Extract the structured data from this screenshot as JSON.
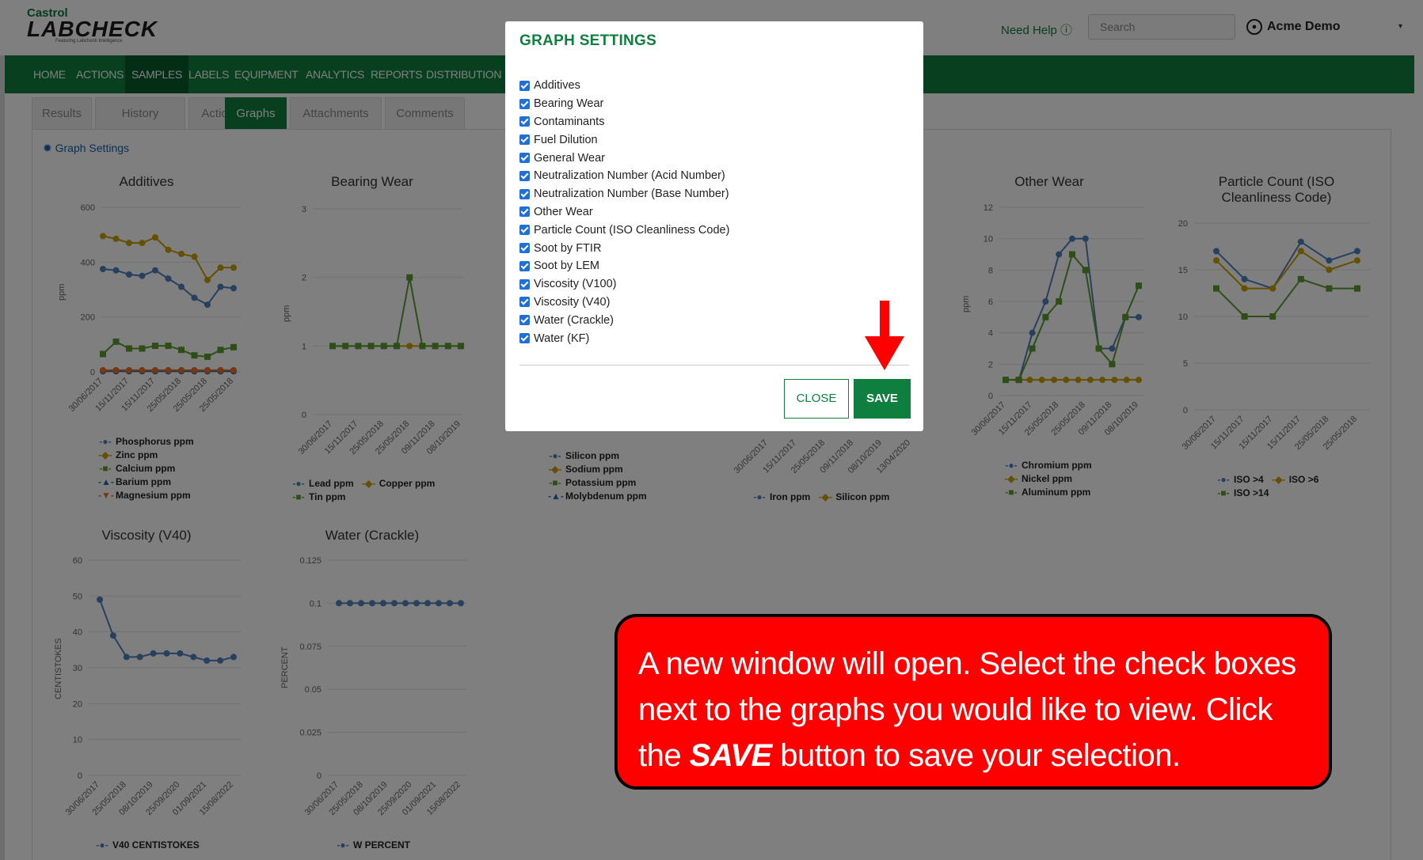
{
  "app": {
    "brand": "Castrol",
    "logo": "LABCHECK",
    "logo_sub": "Featuring Labcheck Intelligence",
    "help": "Need Help ⓘ",
    "search_placeholder": "Search",
    "user": "Acme Demo"
  },
  "nav": [
    "HOME",
    "ACTIONS",
    "SAMPLES",
    "LABELS",
    "EQUIPMENT",
    "ANALYTICS",
    "REPORTS",
    "DISTRIBUTION"
  ],
  "nav_active": "SAMPLES",
  "tabs": [
    "Results",
    "History",
    "Actions",
    "Graphs",
    "Attachments",
    "Comments"
  ],
  "tab_active": "Graphs",
  "graph_settings_link": "Graph Settings",
  "charts": {
    "additives": {
      "title": "Additives",
      "ylabel": "ppm",
      "yticks": [
        "600",
        "400",
        "200",
        "0"
      ],
      "xticks": [
        "30/06/2017",
        "15/11/2017",
        "15/11/2017",
        "25/05/2018",
        "25/05/2018",
        "25/05/2018"
      ],
      "legend": [
        "Phosphorus ppm",
        "Zinc ppm",
        "Calcium ppm",
        "Barium ppm",
        "Magnesium ppm"
      ]
    },
    "bearing": {
      "title": "Bearing Wear",
      "ylabel": "ppm",
      "yticks": [
        "3",
        "2",
        "1",
        "0"
      ],
      "xticks": [
        "30/06/2017",
        "15/11/2017",
        "25/05/2018",
        "25/05/2018",
        "09/11/2018",
        "08/10/2019"
      ],
      "legend": [
        "Lead ppm",
        "Copper ppm",
        "Tin ppm"
      ]
    },
    "contaminants": {
      "legend": [
        "Silicon ppm",
        "Sodium ppm",
        "Potassium ppm",
        "Molybdenum ppm"
      ]
    },
    "general": {
      "xticks": [
        "30/06/2017",
        "15/11/2017",
        "25/05/2018",
        "09/11/2018",
        "08/10/2019",
        "13/04/2020"
      ],
      "legend": [
        "Iron ppm",
        "Silicon ppm"
      ]
    },
    "other": {
      "title": "Other Wear",
      "ylabel": "ppm",
      "yticks": [
        "12",
        "10",
        "8",
        "6",
        "4",
        "2",
        "0"
      ],
      "xticks": [
        "30/06/2017",
        "15/11/2017",
        "25/05/2018",
        "25/05/2018",
        "09/11/2018",
        "08/10/2019"
      ],
      "legend": [
        "Chromium ppm",
        "Nickel ppm",
        "Aluminum ppm"
      ]
    },
    "particle": {
      "title": "Particle Count (ISO Cleanliness Code)",
      "yticks": [
        "20",
        "15",
        "10",
        "5",
        "0"
      ],
      "xticks": [
        "30/06/2017",
        "15/11/2017",
        "15/11/2017",
        "15/11/2017",
        "25/05/2018",
        "25/05/2018"
      ],
      "legend": [
        "ISO >4",
        "ISO >6",
        "ISO >14"
      ]
    },
    "v40": {
      "title": "Viscosity (V40)",
      "ylabel": "CENTISTOKES",
      "yticks": [
        "60",
        "50",
        "40",
        "30",
        "20",
        "10",
        "0"
      ],
      "xticks": [
        "30/06/2017",
        "25/05/2018",
        "08/10/2019",
        "25/09/2020",
        "01/09/2021",
        "15/08/2022"
      ],
      "legend": [
        "V40 CENTISTOKES"
      ]
    },
    "water": {
      "title": "Water (Crackle)",
      "ylabel": "PERCENT",
      "yticks": [
        "0.125",
        "0.1",
        "0.075",
        "0.05",
        "0.025",
        "0"
      ],
      "xticks": [
        "30/06/2017",
        "25/05/2018",
        "08/10/2019",
        "25/09/2020",
        "01/09/2021",
        "15/08/2022"
      ],
      "legend": [
        "W PERCENT"
      ]
    }
  },
  "modal": {
    "title": "GRAPH SETTINGS",
    "options": [
      "Additives",
      "Bearing Wear",
      "Contaminants",
      "Fuel Dilution",
      "General Wear",
      "Neutralization Number (Acid Number)",
      "Neutralization Number (Base Number)",
      "Other Wear",
      "Particle Count (ISO Cleanliness Code)",
      "Soot by FTIR",
      "Soot by LEM",
      "Viscosity (V100)",
      "Viscosity (V40)",
      "Water (Crackle)",
      "Water (KF)"
    ],
    "close_label": "CLOSE",
    "save_label": "SAVE"
  },
  "callout": {
    "line1": "A new window will open. Select the check boxes next to the graphs you would like to view. Click the ",
    "emph": "SAVE",
    "line2": " button to save your selection."
  },
  "colors": {
    "green": "#0f7f3f",
    "blue": "#4f81bd",
    "gold": "#c8a000",
    "lime": "#5a9e2f",
    "orange": "#e8702a",
    "red": "#ff0000"
  }
}
